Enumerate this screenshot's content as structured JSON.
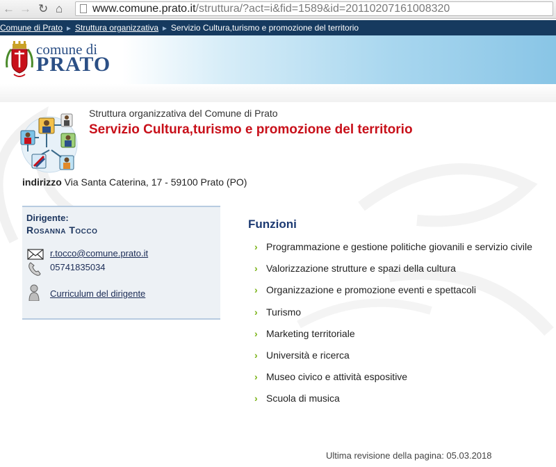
{
  "browser": {
    "url_host": "www.comune.prato.it",
    "url_path": "/struttura/?act=i&fid=1589&id=20110207161008320"
  },
  "breadcrumb": {
    "items": [
      "Comune di Prato",
      "Struttura organizzativa",
      "Servizio Cultura,turismo e promozione del territorio"
    ],
    "separator": "►"
  },
  "header": {
    "logo_line1": "comune di",
    "logo_line2": "PRATO"
  },
  "page": {
    "subtitle": "Struttura organizzativa del Comune di Prato",
    "title": "Servizio Cultura,turismo e promozione del territorio",
    "address_label": "indirizzo",
    "address_value": "Via Santa Caterina, 17 - 59100 Prato (PO)"
  },
  "dirigente": {
    "label": "Dirigente:",
    "name": "Rosanna Tocco",
    "email": "r.tocco@comune.prato.it",
    "phone": "05741835034",
    "cv_label": "Curriculum del dirigente"
  },
  "funzioni": {
    "title": "Funzioni",
    "items": [
      "Programmazione e gestione politiche giovanili e servizio civile",
      "Valorizzazione strutture e spazi della cultura",
      "Organizzazione e promozione eventi e spettacoli",
      "Turismo",
      "Marketing territoriale",
      "Università e ricerca",
      "Museo civico e attività espositive",
      "Scuola di musica"
    ]
  },
  "footer": {
    "revision": "Ultima revisione della pagina: 05.03.2018"
  },
  "colors": {
    "breadcrumb_bg": "#163a5f",
    "title_red": "#c8101a",
    "heading_blue": "#1c3a72",
    "chevron_green": "#7ab317"
  }
}
